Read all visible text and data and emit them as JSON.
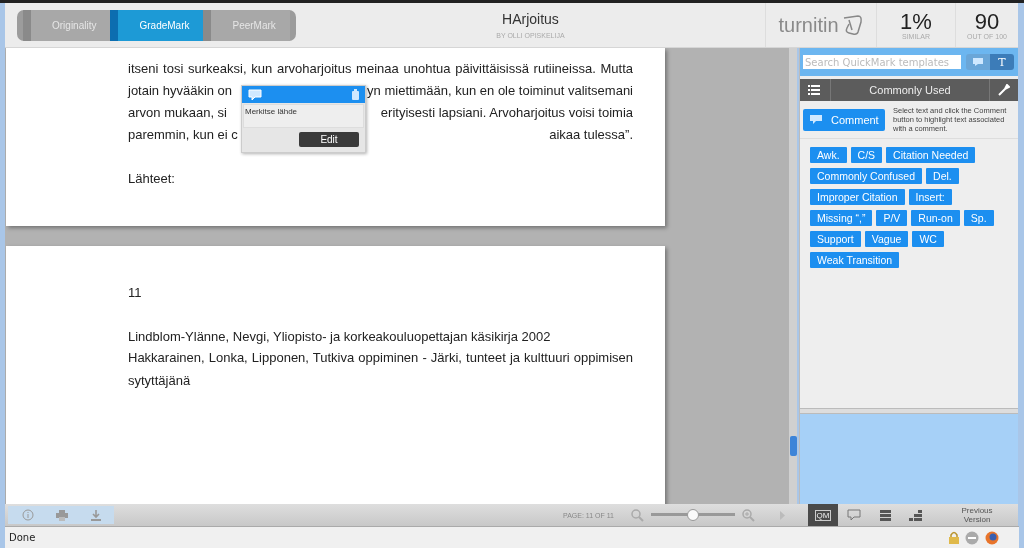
{
  "header": {
    "tabs": [
      {
        "label": "Originality",
        "selected": false
      },
      {
        "label": "GradeMark",
        "selected": true
      },
      {
        "label": "PeerMark",
        "selected": false
      }
    ],
    "title": "HArjoitus",
    "author": "BY OLLI OPISKELIJA",
    "logo": "turnitin",
    "similarity": {
      "value": "1%",
      "label": "SIMILAR"
    },
    "score": {
      "value": "90",
      "label": "OUT OF 100"
    }
  },
  "pages": [
    {
      "paragraphs": [
        {
          "lines": [
            [
              "itseni tosi surkeaksi, kun arvoharjoitus meinaa unohtua päivittäisissä rutiineissa. Mutta"
            ],
            [
              "jotain hyvääkin on",
              "yn miettimään, kun en ole toiminut valitsemani"
            ],
            [
              "arvon mukaan, si",
              "erityisesti lapsiani. Arvoharjoitus voisi toimia"
            ],
            [
              "paremmin, kun ei c",
              "aikaa tulessa”."
            ]
          ]
        },
        {
          "space_before": true,
          "lines": [
            [
              "Lähteet:"
            ]
          ]
        }
      ]
    },
    {
      "paragraphs": [
        {
          "lines": [
            [
              "11"
            ]
          ]
        },
        {
          "space_before": true,
          "lines": [
            [
              "Lindblom-Ylänne, Nevgi, Yliopisto- ja korkeakouluopettajan käsikirja 2002"
            ]
          ]
        },
        {
          "lines": [
            [
              "Hakkarainen, Lonka, Lipponen, Tutkiva oppiminen - Järki, tunteet ja kulttuuri oppimisen"
            ],
            [
              "sytyttäjänä"
            ]
          ]
        }
      ]
    }
  ],
  "popup": {
    "text": "Merkitse lähde",
    "button": "Edit"
  },
  "panel": {
    "search": {
      "placeholder": "Search QuickMark templates"
    },
    "type_button": "T",
    "set_name": "Commonly Used",
    "comment_button": "Comment",
    "help": "Select text and click the Comment button to highlight text associated with a comment.",
    "tags": [
      "Awk.",
      "C/S",
      "Citation Needed",
      "Commonly Confused",
      "Del.",
      "Improper Citation",
      "Insert:",
      "Missing “,”",
      "P/V",
      "Run-on",
      "Sp.",
      "Support",
      "Vague",
      "WC",
      "Weak Transition"
    ]
  },
  "toolbar": {
    "page": "PAGE: 11 OF 11",
    "zoom": {
      "level": 0.5
    },
    "views": [
      {
        "kind": "qm",
        "label": "QM",
        "selected": true
      },
      {
        "kind": "comment",
        "selected": false
      },
      {
        "kind": "list",
        "selected": false
      },
      {
        "kind": "grid",
        "selected": false
      }
    ],
    "previous": "Previous Version"
  },
  "status": "Done"
}
